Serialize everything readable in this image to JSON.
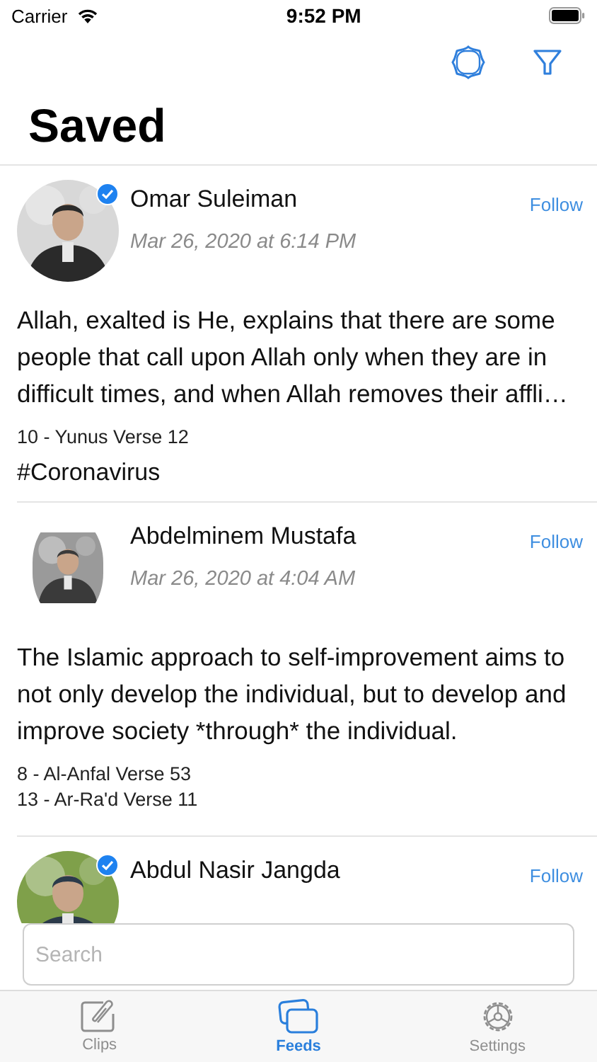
{
  "status_bar": {
    "carrier": "Carrier",
    "time": "9:52 PM"
  },
  "title": "Saved",
  "posts": [
    {
      "author": "Omar Suleiman",
      "verified": true,
      "date": "Mar 26, 2020 at 6:14 PM",
      "follow": "Follow",
      "text": "Allah, exalted is He, explains that there are some people that call upon Allah only when they are in difficult times, and when Allah removes their affli…",
      "verses": [
        "10 - Yunus  Verse 12"
      ],
      "tags": [
        "#Coronavirus"
      ]
    },
    {
      "author": "Abdelminem Mustafa",
      "verified": false,
      "date": "Mar 26, 2020 at 4:04 AM",
      "follow": "Follow",
      "text": "The Islamic approach to self-improvement aims to not only develop the individual, but to develop and improve society *through* the individual.",
      "verses": [
        "8 - Al-Anfal  Verse 53",
        "13 - Ar-Ra'd  Verse 11"
      ]
    },
    {
      "author": "Abdul Nasir Jangda",
      "verified": true,
      "follow": "Follow"
    }
  ],
  "search": {
    "placeholder": "Search"
  },
  "tabs": [
    {
      "label": "Clips",
      "selected": false,
      "kind": "clip"
    },
    {
      "label": "Feeds",
      "selected": true,
      "kind": "cards"
    },
    {
      "label": "Settings",
      "selected": false,
      "kind": "gear"
    }
  ]
}
